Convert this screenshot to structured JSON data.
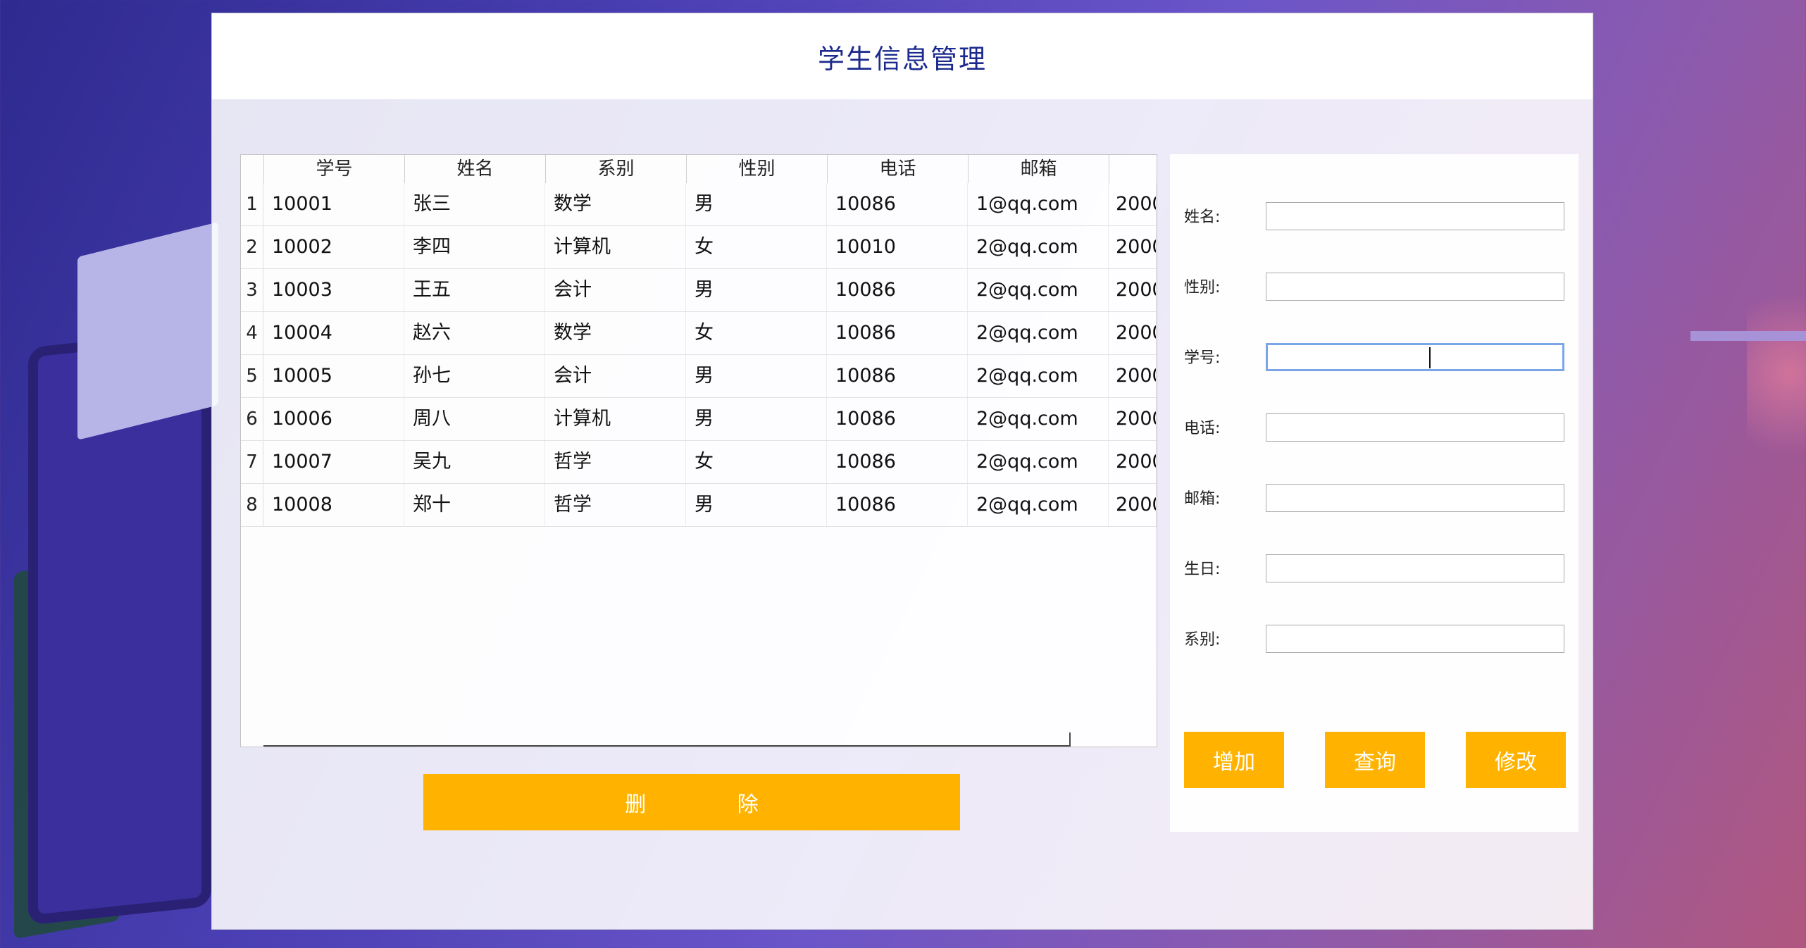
{
  "window": {
    "title": "学生信息管理"
  },
  "table": {
    "headers": [
      "学号",
      "姓名",
      "系别",
      "性别",
      "电话",
      "邮箱",
      ""
    ],
    "rows": [
      {
        "num": "1",
        "id": "10001",
        "name": "张三",
        "dept": "数学",
        "gender": "男",
        "phone": "10086",
        "email": "1@qq.com",
        "birth": "2000"
      },
      {
        "num": "2",
        "id": "10002",
        "name": "李四",
        "dept": "计算机",
        "gender": "女",
        "phone": "10010",
        "email": "2@qq.com",
        "birth": "2000"
      },
      {
        "num": "3",
        "id": "10003",
        "name": "王五",
        "dept": "会计",
        "gender": "男",
        "phone": "10086",
        "email": "2@qq.com",
        "birth": "2000"
      },
      {
        "num": "4",
        "id": "10004",
        "name": "赵六",
        "dept": "数学",
        "gender": "女",
        "phone": "10086",
        "email": "2@qq.com",
        "birth": "2000"
      },
      {
        "num": "5",
        "id": "10005",
        "name": "孙七",
        "dept": "会计",
        "gender": "男",
        "phone": "10086",
        "email": "2@qq.com",
        "birth": "2000"
      },
      {
        "num": "6",
        "id": "10006",
        "name": "周八",
        "dept": "计算机",
        "gender": "男",
        "phone": "10086",
        "email": "2@qq.com",
        "birth": "2000"
      },
      {
        "num": "7",
        "id": "10007",
        "name": "吴九",
        "dept": "哲学",
        "gender": "女",
        "phone": "10086",
        "email": "2@qq.com",
        "birth": "2000"
      },
      {
        "num": "8",
        "id": "10008",
        "name": "郑十",
        "dept": "哲学",
        "gender": "男",
        "phone": "10086",
        "email": "2@qq.com",
        "birth": "2000"
      }
    ]
  },
  "delete_button": "删 除",
  "form": {
    "name_label": "姓名:",
    "gender_label": "性别:",
    "id_label": "学号:",
    "phone_label": "电话:",
    "email_label": "邮箱:",
    "birthday_label": "生日:",
    "dept_label": "系别:",
    "name_value": "",
    "gender_value": "",
    "id_value": "",
    "phone_value": "",
    "email_value": "",
    "birthday_value": "",
    "dept_value": ""
  },
  "actions": {
    "add": "增加",
    "query": "查询",
    "edit": "修改"
  },
  "colors": {
    "accent": "#ffb300",
    "title": "#1b2a8c"
  }
}
